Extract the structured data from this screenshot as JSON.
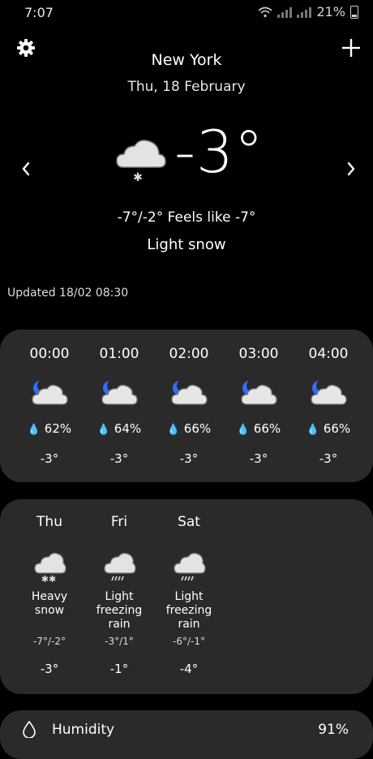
{
  "status": {
    "time": "7:07",
    "battery": "21%"
  },
  "header": {
    "city": "New York",
    "date": "Thu, 18 February"
  },
  "current": {
    "temp": "-3°",
    "range_feels": "-7°/-2° Feels like -7°",
    "condition": "Light snow",
    "updated": "Updated 18/02 08:30"
  },
  "hourly": [
    {
      "time": "00:00",
      "rain": "62%",
      "temp": "-3°",
      "icon": "cloudy-night-icon"
    },
    {
      "time": "01:00",
      "rain": "64%",
      "temp": "-3°",
      "icon": "cloudy-night-icon"
    },
    {
      "time": "02:00",
      "rain": "66%",
      "temp": "-3°",
      "icon": "cloudy-night-icon"
    },
    {
      "time": "03:00",
      "rain": "66%",
      "temp": "-3°",
      "icon": "cloudy-night-icon"
    },
    {
      "time": "04:00",
      "rain": "66%",
      "temp": "-3°",
      "icon": "cloudy-night-icon"
    }
  ],
  "daily": [
    {
      "day": "Thu",
      "condition_lines": [
        "Heavy",
        "snow"
      ],
      "range": "-7°/-2°",
      "temp": "-3°",
      "icon": "heavy-snow-icon"
    },
    {
      "day": "Fri",
      "condition_lines": [
        "Light",
        "freezing",
        "rain"
      ],
      "range": "-3°/1°",
      "temp": "-1°",
      "icon": "freezing-rain-icon"
    },
    {
      "day": "Sat",
      "condition_lines": [
        "Light",
        "freezing",
        "rain"
      ],
      "range": "-6°/-1°",
      "temp": "-4°",
      "icon": "freezing-rain-icon"
    }
  ],
  "details": {
    "humidity_label": "Humidity",
    "humidity_value": "91%"
  },
  "colors": {
    "background": "#000000",
    "card": "#2a2a2a",
    "moon": "#2f6fff",
    "cloud": "#e8e8e8"
  }
}
